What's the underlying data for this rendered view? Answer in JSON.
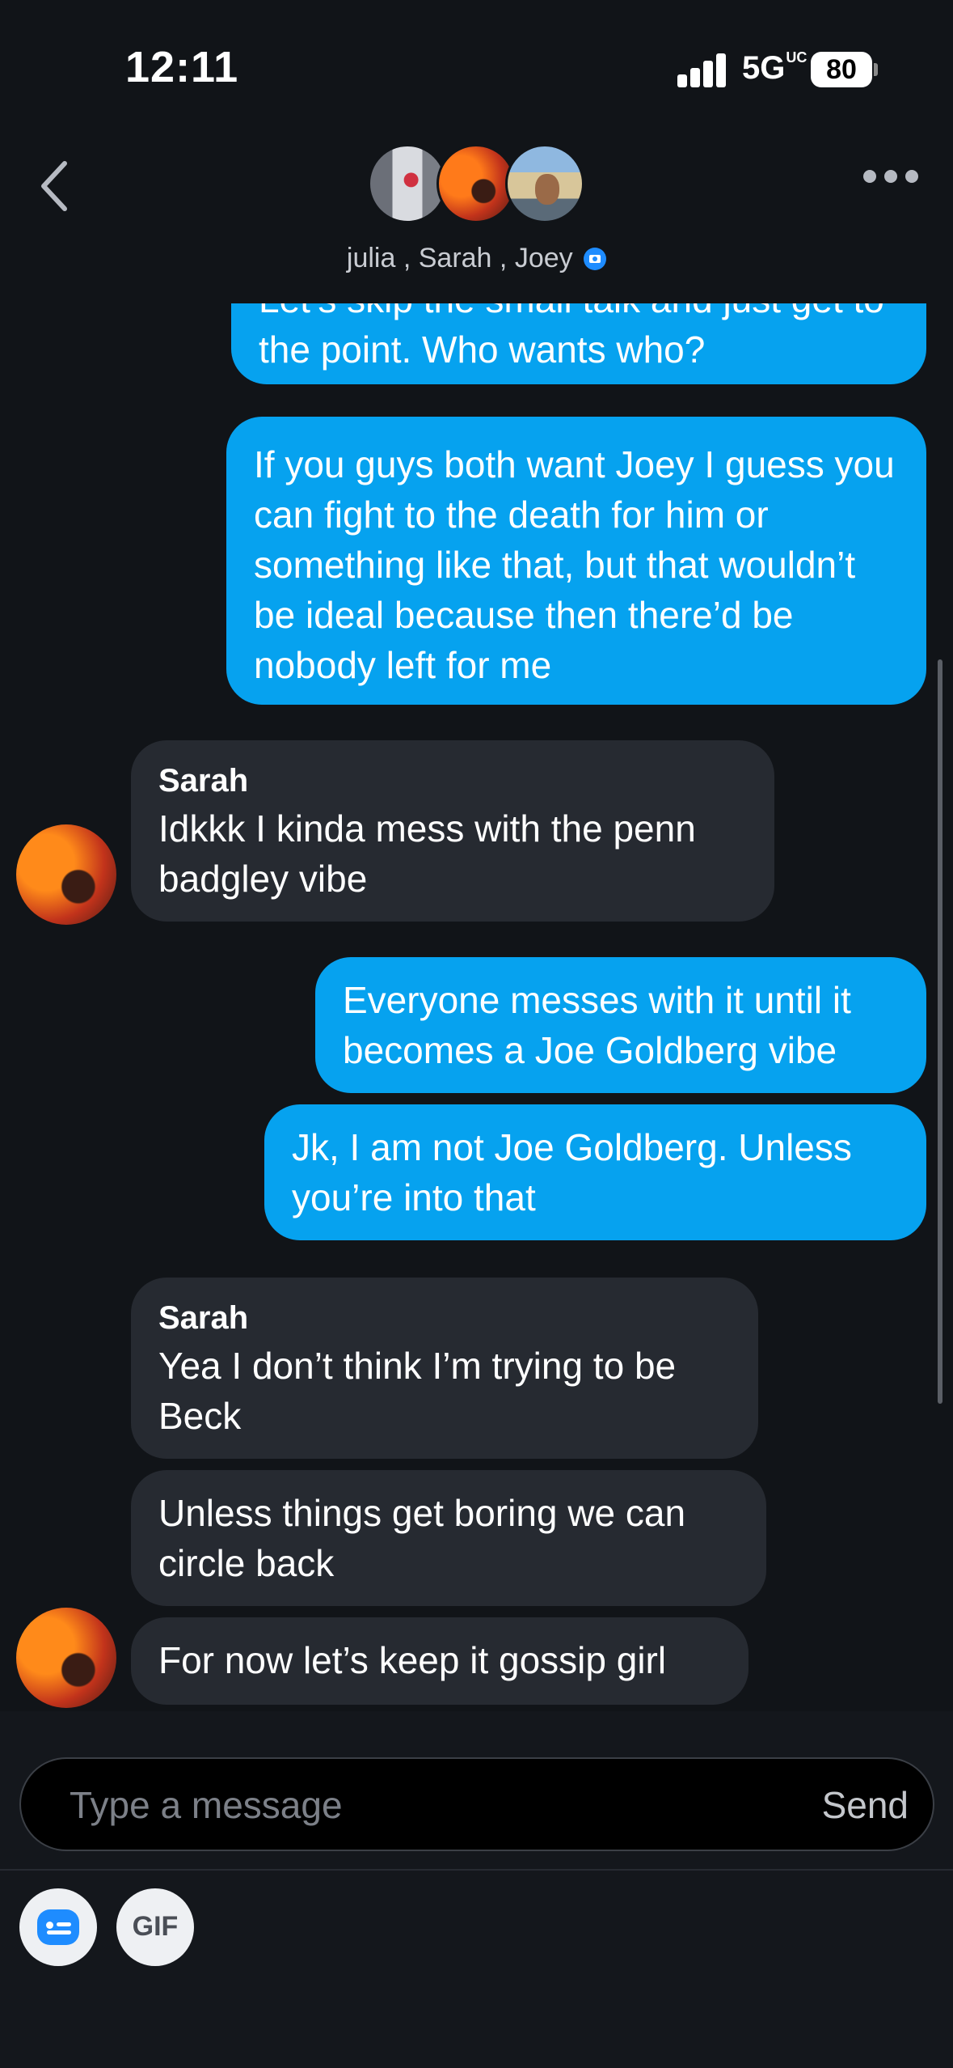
{
  "status_bar": {
    "time": "12:11",
    "network": "5G",
    "network_suffix": "UC",
    "battery": "80"
  },
  "header": {
    "participants": [
      "julia",
      "Sarah",
      "Joey"
    ],
    "separator": " , ",
    "icons": {
      "back": "chevron-left-icon",
      "more": "more-horizontal-icon",
      "badge": "camera-badge-icon"
    }
  },
  "messages": [
    {
      "direction": "out",
      "text": "Let’s skip the small talk and just get to the point. Who wants who?"
    },
    {
      "direction": "out",
      "text": "If you guys both want Joey I guess you can fight to the death for him or something like that, but that wouldn’t be ideal because then there’d be nobody left for me"
    },
    {
      "direction": "in",
      "sender": "Sarah",
      "text": "Idkkk I kinda mess with the penn badgley vibe"
    },
    {
      "direction": "out",
      "text": "Everyone messes with it until it becomes a Joe Goldberg vibe"
    },
    {
      "direction": "out",
      "text": "Jk, I am not Joe Goldberg. Unless you’re into that"
    },
    {
      "direction": "in",
      "sender": "Sarah",
      "text": "Yea I don’t think I’m trying to be Beck"
    },
    {
      "direction": "in",
      "text": "Unless things get boring we can circle back"
    },
    {
      "direction": "in",
      "text": "For now let’s keep it gossip girl"
    }
  ],
  "composer": {
    "placeholder": "Type a message",
    "send_label": "Send",
    "gif_label": "GIF"
  },
  "colors": {
    "background": "#111418",
    "outgoing_bubble": "#06a2ef",
    "incoming_bubble": "#262a31",
    "badge_blue": "#1e8cff"
  }
}
